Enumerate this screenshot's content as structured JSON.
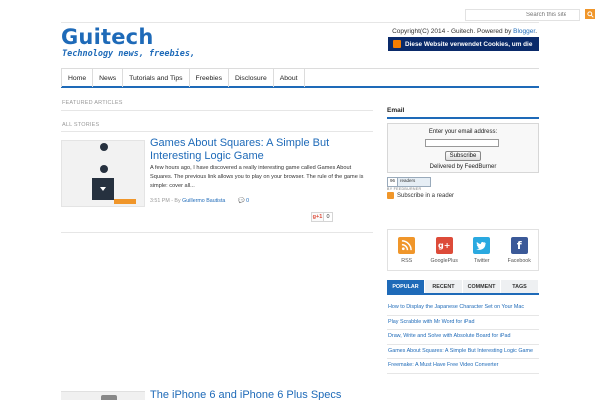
{
  "header": {
    "search_placeholder": "Search this site",
    "logo": "Guitech",
    "tagline": "Technology news, freebies,",
    "copyright_prefix": "Copyright(C) 2014 - Guitech. Powered by ",
    "copyright_link": "Blogger",
    "copyright_suffix": ".",
    "cookie_notice": "Diese Website verwendet Cookies, um die"
  },
  "nav": {
    "items": [
      "Home",
      "News",
      "Tutorials and Tips",
      "Freebies",
      "Disclosure",
      "About"
    ]
  },
  "main": {
    "featured_label": "FEATURED ARTICLES",
    "all_stories_label": "ALL STORIES",
    "posts": [
      {
        "title": "Games About Squares: A Simple But Interesting Logic Game",
        "excerpt": "A few hours ago, I have discovered a really interesting game called Games About Squares. The previous link allows you to play on your browser. The rule of the game is simple: cover all...",
        "time": "3:51 PM - By ",
        "author": "Guillermo Bautista",
        "comments": "0",
        "gplus_label": "g+1",
        "gplus_count": "0"
      },
      {
        "title": "The iPhone 6 and iPhone 6 Plus Specs"
      }
    ]
  },
  "sidebar": {
    "email_title": "Email",
    "email_label": "Enter your email address:",
    "subscribe_button": "Subscribe",
    "delivered_by": "Delivered by FeedBurner",
    "reader_count": "96",
    "reader_word": "readers",
    "feedburner_byline": "BY FEEDBURNER",
    "subscribe_reader": "Subscribe in a reader",
    "social": [
      {
        "name": "RSS",
        "icon": "rss-icon",
        "color": "#f0962a"
      },
      {
        "name": "GooglePlus",
        "icon": "google-plus-icon",
        "color": "#dd4b39"
      },
      {
        "name": "Twitter",
        "icon": "twitter-icon",
        "color": "#2aa9e0"
      },
      {
        "name": "Facebook",
        "icon": "facebook-icon",
        "color": "#3b5998"
      }
    ],
    "tabs": [
      "POPULAR",
      "RECENT",
      "COMMENT",
      "TAGS"
    ],
    "popular": [
      "How to Display the Japanese Character Set on Your Mac",
      "Play Scrabble with Mr Word for iPad",
      "Draw, Write and Solve with Absolute Board for iPad",
      "Games About Squares: A Simple But Interesting Logic Game",
      "Freemake: A Must Have Free Video Converter"
    ]
  },
  "colors": {
    "accent": "#1e6ab8",
    "orange": "#f0962a",
    "cookie_bar": "#0a2a6a"
  }
}
